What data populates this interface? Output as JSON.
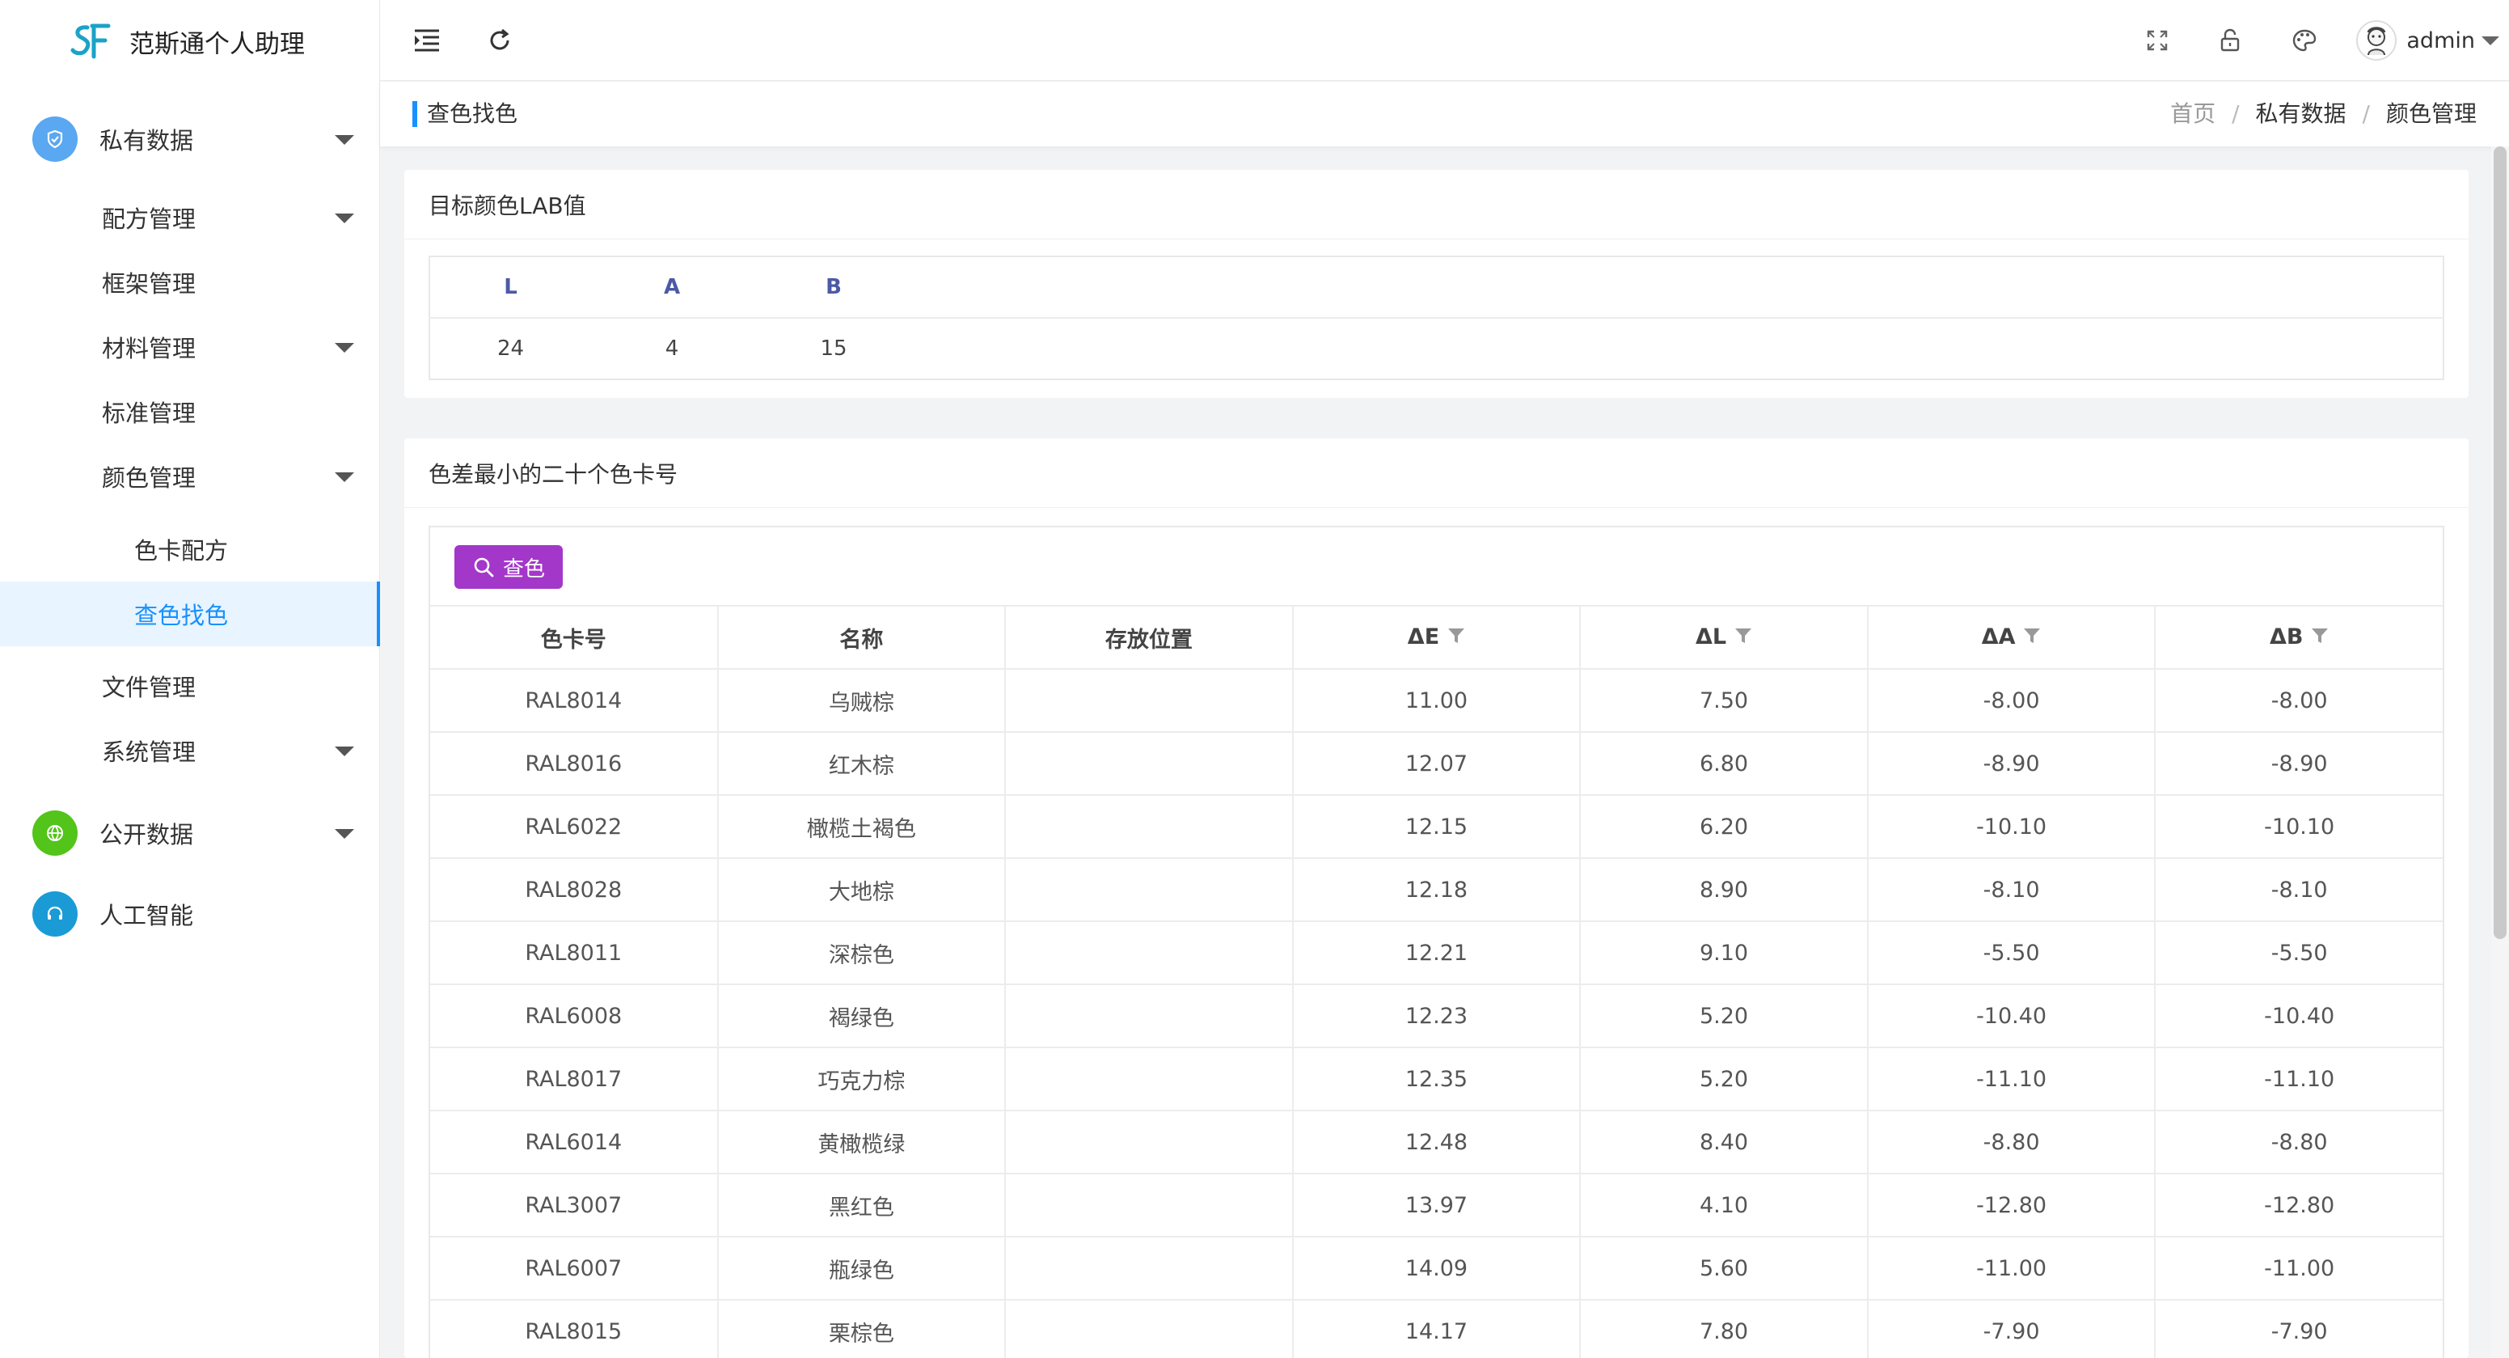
{
  "app": {
    "title": "范斯通个人助理"
  },
  "sidebar": {
    "items": [
      {
        "label": "私有数据"
      },
      {
        "label": "配方管理"
      },
      {
        "label": "框架管理"
      },
      {
        "label": "材料管理"
      },
      {
        "label": "标准管理"
      },
      {
        "label": "颜色管理"
      },
      {
        "label": "色卡配方"
      },
      {
        "label": "查色找色"
      },
      {
        "label": "文件管理"
      },
      {
        "label": "系统管理"
      },
      {
        "label": "公开数据"
      },
      {
        "label": "人工智能"
      }
    ]
  },
  "topbar": {
    "user_name": "admin"
  },
  "page": {
    "title": "查色找色"
  },
  "breadcrumb": {
    "home": "首页",
    "section": "私有数据",
    "current": "颜色管理"
  },
  "lab_card": {
    "title": "目标颜色LAB值",
    "headers": [
      "L",
      "A",
      "B"
    ],
    "values": [
      "24",
      "4",
      "15"
    ]
  },
  "result_card": {
    "title": "色差最小的二十个色卡号",
    "search_label": "查色",
    "headers": [
      "色卡号",
      "名称",
      "存放位置",
      "ΔE",
      "ΔL",
      "ΔA",
      "ΔB"
    ],
    "rows": [
      [
        "RAL8014",
        "乌贼棕",
        "",
        "11.00",
        "7.50",
        "-8.00",
        "-8.00"
      ],
      [
        "RAL8016",
        "红木棕",
        "",
        "12.07",
        "6.80",
        "-8.90",
        "-8.90"
      ],
      [
        "RAL6022",
        "橄榄土褐色",
        "",
        "12.15",
        "6.20",
        "-10.10",
        "-10.10"
      ],
      [
        "RAL8028",
        "大地棕",
        "",
        "12.18",
        "8.90",
        "-8.10",
        "-8.10"
      ],
      [
        "RAL8011",
        "深棕色",
        "",
        "12.21",
        "9.10",
        "-5.50",
        "-5.50"
      ],
      [
        "RAL6008",
        "褐绿色",
        "",
        "12.23",
        "5.20",
        "-10.40",
        "-10.40"
      ],
      [
        "RAL8017",
        "巧克力棕",
        "",
        "12.35",
        "5.20",
        "-11.10",
        "-11.10"
      ],
      [
        "RAL6014",
        "黄橄榄绿",
        "",
        "12.48",
        "8.40",
        "-8.80",
        "-8.80"
      ],
      [
        "RAL3007",
        "黑红色",
        "",
        "13.97",
        "4.10",
        "-12.80",
        "-12.80"
      ],
      [
        "RAL6007",
        "瓶绿色",
        "",
        "14.09",
        "5.60",
        "-11.00",
        "-11.00"
      ],
      [
        "RAL8015",
        "栗棕色",
        "",
        "14.17",
        "7.80",
        "-7.90",
        "-7.90"
      ]
    ]
  },
  "colors": {
    "accent": "#1890ff",
    "search_button": "#a337c9",
    "private_icon": "#5aa7f2",
    "public_icon": "#52c41a",
    "ai_icon": "#1a9bd6"
  }
}
